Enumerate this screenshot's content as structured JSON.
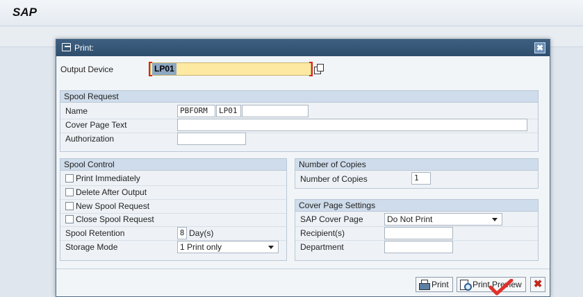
{
  "app": {
    "title": "SAP"
  },
  "dialog": {
    "title": "Print:",
    "close_label": "✖",
    "output_device": {
      "label": "Output Device",
      "value": "LP01"
    },
    "spool_request": {
      "header": "Spool Request",
      "name_label": "Name",
      "name_parts": [
        "PBFORM",
        "LP01",
        ""
      ],
      "cover_page_text_label": "Cover Page Text",
      "cover_page_text_value": "",
      "authorization_label": "Authorization",
      "authorization_value": ""
    },
    "spool_control": {
      "header": "Spool Control",
      "print_immediately": {
        "label": "Print Immediately",
        "checked": false
      },
      "delete_after_output": {
        "label": "Delete After Output",
        "checked": false
      },
      "new_spool_request": {
        "label": "New Spool Request",
        "checked": false
      },
      "close_spool_request": {
        "label": "Close Spool Request",
        "checked": false
      },
      "spool_retention_label": "Spool Retention",
      "spool_retention_value": "8",
      "spool_retention_unit": "Day(s)",
      "storage_mode_label": "Storage Mode",
      "storage_mode_value": "1 Print only"
    },
    "number_of_copies": {
      "header": "Number of Copies",
      "label": "Number of Copies",
      "value": "1"
    },
    "cover_page_settings": {
      "header": "Cover Page Settings",
      "sap_cover_page_label": "SAP Cover Page",
      "sap_cover_page_value": "Do Not Print",
      "recipients_label": "Recipient(s)",
      "recipients_value": "",
      "department_label": "Department",
      "department_value": ""
    },
    "buttons": {
      "print": "Print",
      "print_preview": "Print Preview",
      "cancel": "✖"
    }
  },
  "colors": {
    "titlebar": "#2f4e6e",
    "output_field_bg": "#fde9a2",
    "selection_highlight": "#8da7c3",
    "required_bracket": "#d9261c",
    "cancel": "#c0271d",
    "check_mark": "#e0302a"
  }
}
